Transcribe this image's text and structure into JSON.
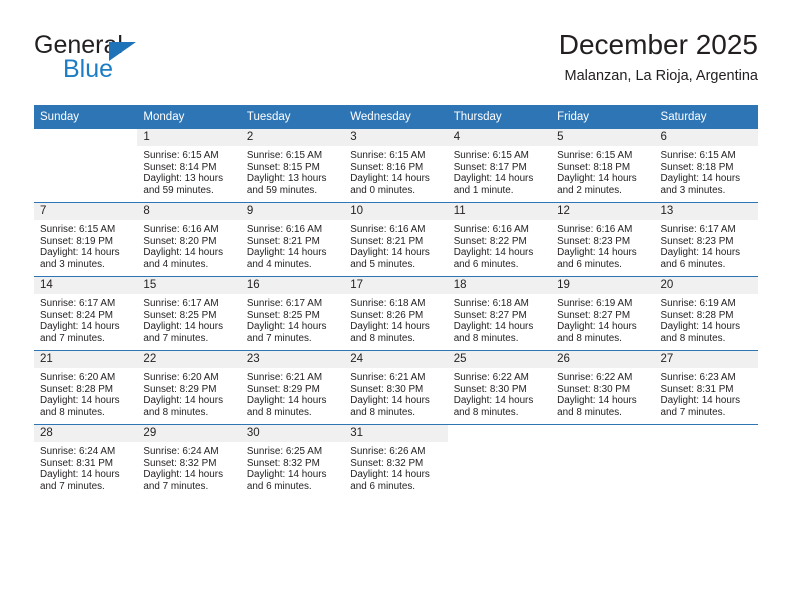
{
  "brand": {
    "name_top": "General",
    "name_bottom": "Blue",
    "accent_color": "#1c7cc4",
    "triangle_color": "#1e72b8"
  },
  "header": {
    "title": "December 2025",
    "subtitle": "Malanzan, La Rioja, Argentina"
  },
  "theme": {
    "header_blue": "#2e75b6",
    "date_band_gray": "#f0f0f0",
    "text_color": "#231f20"
  },
  "calendar": {
    "weekday_headers": [
      "Sunday",
      "Monday",
      "Tuesday",
      "Wednesday",
      "Thursday",
      "Friday",
      "Saturday"
    ],
    "weeks": [
      [
        {
          "date": "",
          "lines": []
        },
        {
          "date": "1",
          "lines": [
            "Sunrise: 6:15 AM",
            "Sunset: 8:14 PM",
            "Daylight: 13 hours",
            "and 59 minutes."
          ]
        },
        {
          "date": "2",
          "lines": [
            "Sunrise: 6:15 AM",
            "Sunset: 8:15 PM",
            "Daylight: 13 hours",
            "and 59 minutes."
          ]
        },
        {
          "date": "3",
          "lines": [
            "Sunrise: 6:15 AM",
            "Sunset: 8:16 PM",
            "Daylight: 14 hours",
            "and 0 minutes."
          ]
        },
        {
          "date": "4",
          "lines": [
            "Sunrise: 6:15 AM",
            "Sunset: 8:17 PM",
            "Daylight: 14 hours",
            "and 1 minute."
          ]
        },
        {
          "date": "5",
          "lines": [
            "Sunrise: 6:15 AM",
            "Sunset: 8:18 PM",
            "Daylight: 14 hours",
            "and 2 minutes."
          ]
        },
        {
          "date": "6",
          "lines": [
            "Sunrise: 6:15 AM",
            "Sunset: 8:18 PM",
            "Daylight: 14 hours",
            "and 3 minutes."
          ]
        }
      ],
      [
        {
          "date": "7",
          "lines": [
            "Sunrise: 6:15 AM",
            "Sunset: 8:19 PM",
            "Daylight: 14 hours",
            "and 3 minutes."
          ]
        },
        {
          "date": "8",
          "lines": [
            "Sunrise: 6:16 AM",
            "Sunset: 8:20 PM",
            "Daylight: 14 hours",
            "and 4 minutes."
          ]
        },
        {
          "date": "9",
          "lines": [
            "Sunrise: 6:16 AM",
            "Sunset: 8:21 PM",
            "Daylight: 14 hours",
            "and 4 minutes."
          ]
        },
        {
          "date": "10",
          "lines": [
            "Sunrise: 6:16 AM",
            "Sunset: 8:21 PM",
            "Daylight: 14 hours",
            "and 5 minutes."
          ]
        },
        {
          "date": "11",
          "lines": [
            "Sunrise: 6:16 AM",
            "Sunset: 8:22 PM",
            "Daylight: 14 hours",
            "and 6 minutes."
          ]
        },
        {
          "date": "12",
          "lines": [
            "Sunrise: 6:16 AM",
            "Sunset: 8:23 PM",
            "Daylight: 14 hours",
            "and 6 minutes."
          ]
        },
        {
          "date": "13",
          "lines": [
            "Sunrise: 6:17 AM",
            "Sunset: 8:23 PM",
            "Daylight: 14 hours",
            "and 6 minutes."
          ]
        }
      ],
      [
        {
          "date": "14",
          "lines": [
            "Sunrise: 6:17 AM",
            "Sunset: 8:24 PM",
            "Daylight: 14 hours",
            "and 7 minutes."
          ]
        },
        {
          "date": "15",
          "lines": [
            "Sunrise: 6:17 AM",
            "Sunset: 8:25 PM",
            "Daylight: 14 hours",
            "and 7 minutes."
          ]
        },
        {
          "date": "16",
          "lines": [
            "Sunrise: 6:17 AM",
            "Sunset: 8:25 PM",
            "Daylight: 14 hours",
            "and 7 minutes."
          ]
        },
        {
          "date": "17",
          "lines": [
            "Sunrise: 6:18 AM",
            "Sunset: 8:26 PM",
            "Daylight: 14 hours",
            "and 8 minutes."
          ]
        },
        {
          "date": "18",
          "lines": [
            "Sunrise: 6:18 AM",
            "Sunset: 8:27 PM",
            "Daylight: 14 hours",
            "and 8 minutes."
          ]
        },
        {
          "date": "19",
          "lines": [
            "Sunrise: 6:19 AM",
            "Sunset: 8:27 PM",
            "Daylight: 14 hours",
            "and 8 minutes."
          ]
        },
        {
          "date": "20",
          "lines": [
            "Sunrise: 6:19 AM",
            "Sunset: 8:28 PM",
            "Daylight: 14 hours",
            "and 8 minutes."
          ]
        }
      ],
      [
        {
          "date": "21",
          "lines": [
            "Sunrise: 6:20 AM",
            "Sunset: 8:28 PM",
            "Daylight: 14 hours",
            "and 8 minutes."
          ]
        },
        {
          "date": "22",
          "lines": [
            "Sunrise: 6:20 AM",
            "Sunset: 8:29 PM",
            "Daylight: 14 hours",
            "and 8 minutes."
          ]
        },
        {
          "date": "23",
          "lines": [
            "Sunrise: 6:21 AM",
            "Sunset: 8:29 PM",
            "Daylight: 14 hours",
            "and 8 minutes."
          ]
        },
        {
          "date": "24",
          "lines": [
            "Sunrise: 6:21 AM",
            "Sunset: 8:30 PM",
            "Daylight: 14 hours",
            "and 8 minutes."
          ]
        },
        {
          "date": "25",
          "lines": [
            "Sunrise: 6:22 AM",
            "Sunset: 8:30 PM",
            "Daylight: 14 hours",
            "and 8 minutes."
          ]
        },
        {
          "date": "26",
          "lines": [
            "Sunrise: 6:22 AM",
            "Sunset: 8:30 PM",
            "Daylight: 14 hours",
            "and 8 minutes."
          ]
        },
        {
          "date": "27",
          "lines": [
            "Sunrise: 6:23 AM",
            "Sunset: 8:31 PM",
            "Daylight: 14 hours",
            "and 7 minutes."
          ]
        }
      ],
      [
        {
          "date": "28",
          "lines": [
            "Sunrise: 6:24 AM",
            "Sunset: 8:31 PM",
            "Daylight: 14 hours",
            "and 7 minutes."
          ]
        },
        {
          "date": "29",
          "lines": [
            "Sunrise: 6:24 AM",
            "Sunset: 8:32 PM",
            "Daylight: 14 hours",
            "and 7 minutes."
          ]
        },
        {
          "date": "30",
          "lines": [
            "Sunrise: 6:25 AM",
            "Sunset: 8:32 PM",
            "Daylight: 14 hours",
            "and 6 minutes."
          ]
        },
        {
          "date": "31",
          "lines": [
            "Sunrise: 6:26 AM",
            "Sunset: 8:32 PM",
            "Daylight: 14 hours",
            "and 6 minutes."
          ]
        },
        {
          "date": "",
          "lines": []
        },
        {
          "date": "",
          "lines": []
        },
        {
          "date": "",
          "lines": []
        }
      ]
    ]
  }
}
